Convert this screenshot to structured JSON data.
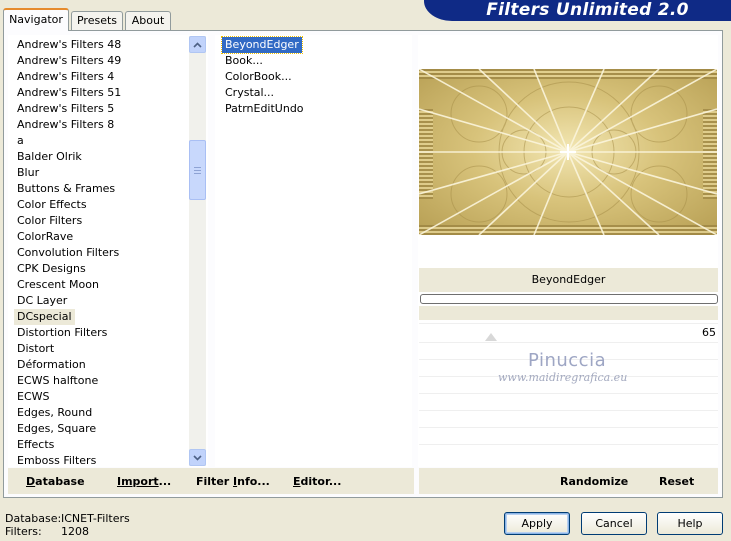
{
  "tabs": [
    {
      "label": "Navigator",
      "active": true
    },
    {
      "label": "Presets",
      "active": false
    },
    {
      "label": "About",
      "active": false
    }
  ],
  "banner": {
    "title": "Filters Unlimited 2.0"
  },
  "categories": {
    "items": [
      "Andrew's Filters 48",
      "Andrew's Filters 49",
      "Andrew's Filters 4",
      "Andrew's Filters 51",
      "Andrew's Filters 5",
      "Andrew's Filters 8",
      "a",
      "Balder Olrik",
      "Blur",
      "Buttons & Frames",
      "Color Effects",
      "Color Filters",
      "ColorRave",
      "Convolution Filters",
      "CPK Designs",
      "Crescent Moon",
      "DC Layer",
      "DCspecial",
      "Distortion Filters",
      "Distort",
      "Déformation",
      "ECWS halftone",
      "ECWS",
      "Edges, Round",
      "Edges, Square",
      "Effects",
      "Emboss Filters"
    ],
    "selected": "DCspecial"
  },
  "filters": {
    "items": [
      "BeyondEdger",
      "Book...",
      "ColorBook...",
      "Crystal...",
      "PatrnEditUndo"
    ],
    "selected": "BeyondEdger"
  },
  "preview": {
    "filter_name": "BeyondEdger",
    "slider_value": "65",
    "progress": 0
  },
  "watermark": {
    "name": "Pinuccia",
    "url": "www.maidiregrafica.eu"
  },
  "bottom_buttons": {
    "database": {
      "underlined": "D",
      "rest": "atabase"
    },
    "import": {
      "pre": "Import",
      "rest": "..."
    },
    "filter_info": {
      "pre": "Filter ",
      "underlined": "I",
      "rest": "nfo..."
    },
    "editor": {
      "underlined": "E",
      "rest": "ditor..."
    },
    "randomize": "Randomize",
    "reset": "Reset"
  },
  "info": {
    "database_label": "Database:",
    "database_value": "ICNET-Filters",
    "filters_label": "Filters:",
    "filters_value": "1208"
  },
  "dialog_buttons": {
    "apply": "Apply",
    "cancel": "Cancel",
    "help": "Help"
  },
  "colors": {
    "selection": "#316ac5",
    "banner": "#0f2a86",
    "preview_gold": "#d6bf6a"
  }
}
